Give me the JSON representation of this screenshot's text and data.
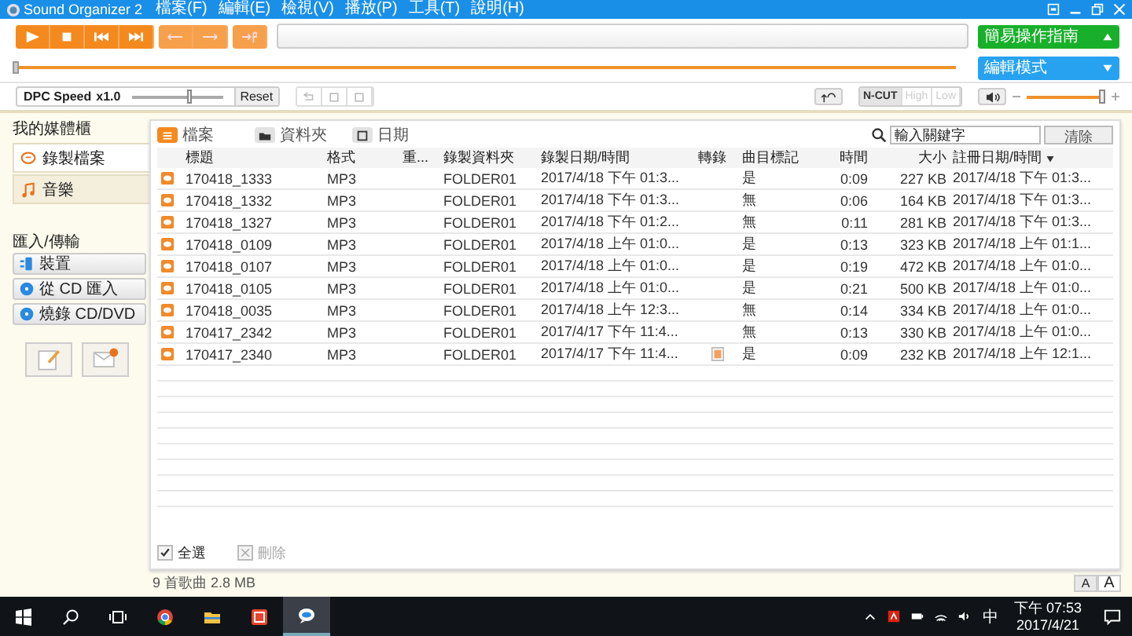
{
  "window": {
    "title": "Sound Organizer 2"
  },
  "menu": [
    "檔案(F)",
    "編輯(E)",
    "檢視(V)",
    "播放(P)",
    "工具(T)",
    "說明(H)"
  ],
  "toolbar": {
    "transport": [
      {
        "kind": "play"
      },
      {
        "kind": "stop"
      },
      {
        "kind": "prev"
      },
      {
        "kind": "next"
      }
    ],
    "guide_button": "簡易操作指南",
    "mode_button": "編輯模式"
  },
  "seek": {
    "level": 0.0
  },
  "dpc": {
    "label": "DPC Speed",
    "value": "x1.0",
    "level": 0.6,
    "reset": "Reset"
  },
  "filters": [
    {
      "label": "N-CUT",
      "selected": true
    },
    {
      "label": "High",
      "selected": false
    },
    {
      "label": "Low",
      "selected": false
    }
  ],
  "volume": {
    "level": 0.95
  },
  "sidebar": {
    "title": "我的媒體櫃",
    "items": [
      {
        "label": "錄製檔案",
        "selected": true,
        "kind": "recording"
      },
      {
        "label": "音樂",
        "selected": false,
        "kind": "music"
      }
    ],
    "section": "匯入/傳輸",
    "transfer": [
      {
        "label": "裝置",
        "kind": "device"
      },
      {
        "label": "從 CD 匯入",
        "kind": "cd"
      },
      {
        "label": "燒錄 CD/DVD",
        "kind": "burn"
      }
    ]
  },
  "view_tabs": [
    {
      "label": "檔案",
      "selected": true,
      "kind": "list"
    },
    {
      "label": "資料夾",
      "selected": false,
      "kind": "folder"
    },
    {
      "label": "日期",
      "selected": false,
      "kind": "date"
    }
  ],
  "search": {
    "placeholder": "輸入關鍵字",
    "clear": "清除"
  },
  "table": {
    "columns": [
      "標題",
      "格式",
      "重...",
      "錄製資料夾",
      "錄製日期/時間",
      "轉錄",
      "曲目標記",
      "時間",
      "大小",
      "註冊日期/時間"
    ],
    "rows": [
      {
        "title": "170418_1333",
        "format": "MP3",
        "folder": "FOLDER01",
        "recorded": "2017/4/18 下午 01:3...",
        "transcribed": false,
        "mark": "是",
        "time": "0:09",
        "size": "227 KB",
        "registered": "2017/4/18 下午 01:3..."
      },
      {
        "title": "170418_1332",
        "format": "MP3",
        "folder": "FOLDER01",
        "recorded": "2017/4/18 下午 01:3...",
        "transcribed": false,
        "mark": "無",
        "time": "0:06",
        "size": "164 KB",
        "registered": "2017/4/18 下午 01:3..."
      },
      {
        "title": "170418_1327",
        "format": "MP3",
        "folder": "FOLDER01",
        "recorded": "2017/4/18 下午 01:2...",
        "transcribed": false,
        "mark": "無",
        "time": "0:11",
        "size": "281 KB",
        "registered": "2017/4/18 下午 01:3..."
      },
      {
        "title": "170418_0109",
        "format": "MP3",
        "folder": "FOLDER01",
        "recorded": "2017/4/18 上午 01:0...",
        "transcribed": false,
        "mark": "是",
        "time": "0:13",
        "size": "323 KB",
        "registered": "2017/4/18 上午 01:1..."
      },
      {
        "title": "170418_0107",
        "format": "MP3",
        "folder": "FOLDER01",
        "recorded": "2017/4/18 上午 01:0...",
        "transcribed": false,
        "mark": "是",
        "time": "0:19",
        "size": "472 KB",
        "registered": "2017/4/18 上午 01:0..."
      },
      {
        "title": "170418_0105",
        "format": "MP3",
        "folder": "FOLDER01",
        "recorded": "2017/4/18 上午 01:0...",
        "transcribed": false,
        "mark": "是",
        "time": "0:21",
        "size": "500 KB",
        "registered": "2017/4/18 上午 01:0..."
      },
      {
        "title": "170418_0035",
        "format": "MP3",
        "folder": "FOLDER01",
        "recorded": "2017/4/18 上午 12:3...",
        "transcribed": false,
        "mark": "無",
        "time": "0:14",
        "size": "334 KB",
        "registered": "2017/4/18 上午 01:0..."
      },
      {
        "title": "170417_2342",
        "format": "MP3",
        "folder": "FOLDER01",
        "recorded": "2017/4/17 下午 11:4...",
        "transcribed": false,
        "mark": "無",
        "time": "0:13",
        "size": "330 KB",
        "registered": "2017/4/18 上午 01:0..."
      },
      {
        "title": "170417_2340",
        "format": "MP3",
        "folder": "FOLDER01",
        "recorded": "2017/4/17 下午 11:4...",
        "transcribed": true,
        "mark": "是",
        "time": "0:09",
        "size": "232 KB",
        "registered": "2017/4/18 上午 12:1..."
      }
    ]
  },
  "footer": {
    "select_all": {
      "label": "全選",
      "checked": true
    },
    "delete": {
      "label": "刪除",
      "disabled": true
    }
  },
  "status": "9 首歌曲 2.8 MB",
  "font_size_buttons": [
    {
      "label": "A",
      "selected": false
    },
    {
      "label": "A",
      "selected": true
    }
  ],
  "taskbar": {
    "ime": "中",
    "time": "下午 07:53",
    "date": "2017/4/21"
  }
}
